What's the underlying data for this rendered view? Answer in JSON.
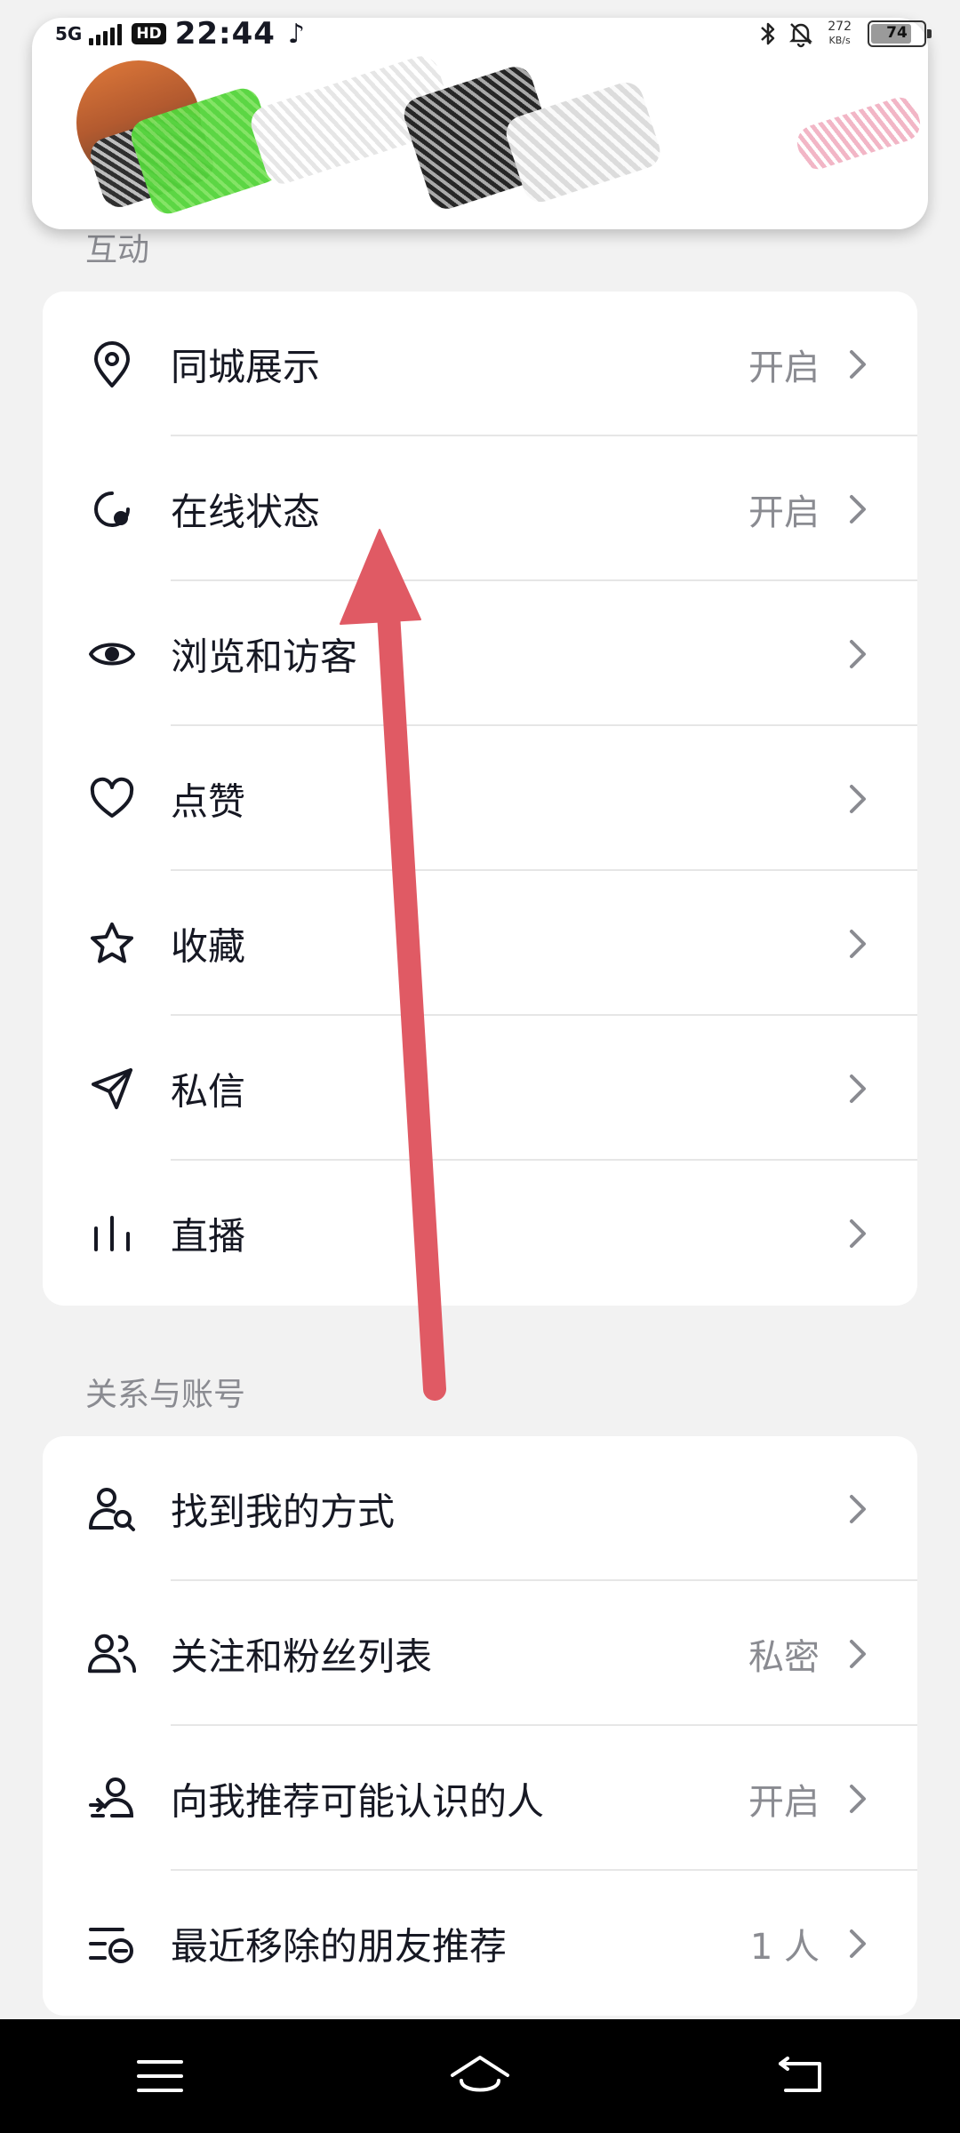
{
  "status_bar": {
    "network": "5G",
    "hd": "HD",
    "time": "22:44",
    "app_glyph": "♪",
    "net_speed_value": "272",
    "net_speed_unit": "KB/s",
    "battery": "74",
    "icons": [
      "bluetooth-icon",
      "bell-off-icon",
      "battery-icon"
    ]
  },
  "notification": {
    "redacted": true
  },
  "sections": [
    {
      "title": "互动",
      "rows": [
        {
          "icon": "location-pin-icon",
          "label": "同城展示",
          "value": "开启"
        },
        {
          "icon": "online-status-icon",
          "label": "在线状态",
          "value": "开启"
        },
        {
          "icon": "eye-icon",
          "label": "浏览和访客",
          "value": ""
        },
        {
          "icon": "heart-icon",
          "label": "点赞",
          "value": ""
        },
        {
          "icon": "star-icon",
          "label": "收藏",
          "value": ""
        },
        {
          "icon": "paper-plane-icon",
          "label": "私信",
          "value": ""
        },
        {
          "icon": "live-bars-icon",
          "label": "直播",
          "value": ""
        }
      ]
    },
    {
      "title": "关系与账号",
      "rows": [
        {
          "icon": "find-person-icon",
          "label": "找到我的方式",
          "value": ""
        },
        {
          "icon": "people-icon",
          "label": "关注和粉丝列表",
          "value": "私密"
        },
        {
          "icon": "recommend-person-icon",
          "label": "向我推荐可能认识的人",
          "value": "开启"
        },
        {
          "icon": "removed-list-icon",
          "label": "最近移除的朋友推荐",
          "value": "1 人"
        }
      ]
    }
  ],
  "nav_bar": {
    "icons": [
      "menu-icon",
      "home-icon",
      "back-icon"
    ]
  },
  "colors": {
    "background": "#f2f2f2",
    "card": "#ffffff",
    "text": "#161823",
    "secondary_text": "#8a8b91",
    "annotation_arrow": "#e05a64"
  }
}
